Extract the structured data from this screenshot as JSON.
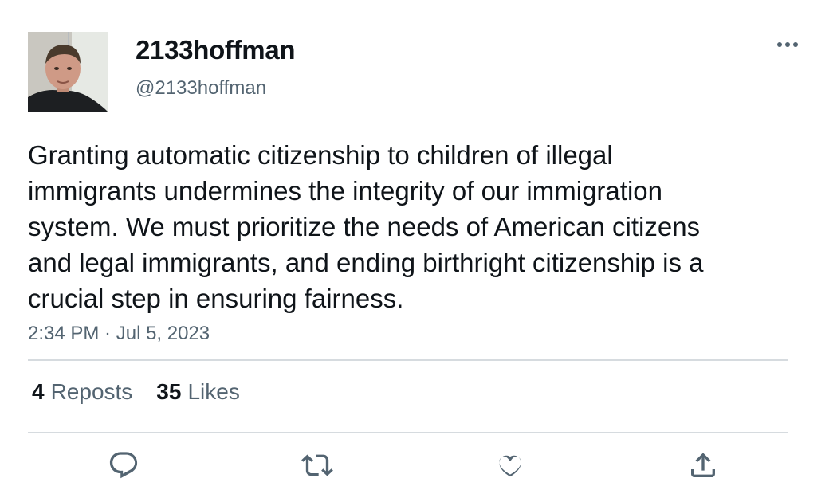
{
  "user": {
    "display_name": "2133hoffman",
    "handle": "@2133hoffman",
    "avatar_icon": "profile-photo"
  },
  "tweet": {
    "text": "Granting automatic citizenship to children of illegal immigrants undermines the integrity of our immigration system. We must prioritize the needs of American citizens and legal immigrants, and ending birthright citizenship is a crucial step in ensuring fairness.",
    "time": "2:34 PM",
    "separator": " · ",
    "date": "Jul 5, 2023"
  },
  "stats": {
    "reposts_count": "4",
    "reposts_label": "Reposts",
    "likes_count": "35",
    "likes_label": "Likes"
  },
  "actions": {
    "reply_icon": "reply-icon",
    "repost_icon": "repost-icon",
    "like_icon": "heart-icon",
    "share_icon": "share-icon",
    "more_icon": "more-horizontal-icon"
  },
  "colors": {
    "text_primary": "#0f1419",
    "text_secondary": "#536471",
    "divider": "#d6dbdf"
  }
}
